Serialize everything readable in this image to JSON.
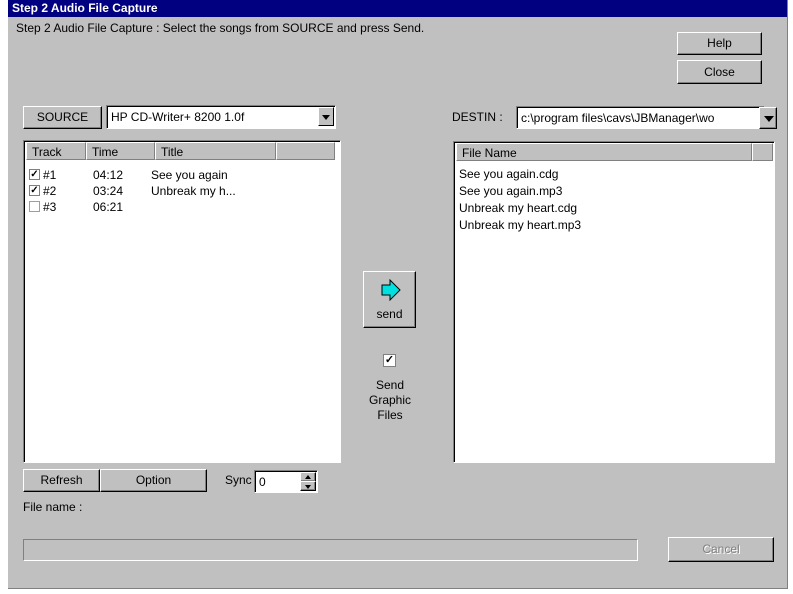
{
  "window": {
    "title": "Step 2 Audio File Capture"
  },
  "instruction": "Step 2 Audio File Capture :  Select the songs from SOURCE and press Send.",
  "buttons": {
    "help": "Help",
    "close": "Close",
    "source": "SOURCE",
    "refresh": "Refresh",
    "option": "Option",
    "send": "send",
    "cancel": "Cancel"
  },
  "source": {
    "selected": "HP CD-Writer+ 8200 1.0f"
  },
  "destin": {
    "label": "DESTIN :",
    "path": "c:\\program files\\cavs\\JBManager\\wo"
  },
  "track_table": {
    "headers": [
      "Track",
      "Time",
      "Title"
    ],
    "rows": [
      {
        "track": "#1",
        "time": "04:12",
        "title": "See you again",
        "checked": true
      },
      {
        "track": "#2",
        "time": "03:24",
        "title": "Unbreak my h...",
        "checked": true
      },
      {
        "track": "#3",
        "time": "06:21",
        "title": "",
        "checked": false
      }
    ]
  },
  "file_table": {
    "header": "File Name",
    "files": [
      "See you again.cdg",
      "See you again.mp3",
      "Unbreak my heart.cdg",
      "Unbreak my heart.mp3"
    ]
  },
  "graphic_option": {
    "label_line1": "Send",
    "label_line2": "Graphic",
    "label_line3": "Files",
    "checked": true
  },
  "sync": {
    "label": "Sync",
    "value": "0"
  },
  "file_name_label": "File name :",
  "progress": {
    "fraction": 0
  },
  "colors": {
    "titlebar": "#000080",
    "face": "#c0c0c0",
    "arrow": "#00e0e0"
  }
}
